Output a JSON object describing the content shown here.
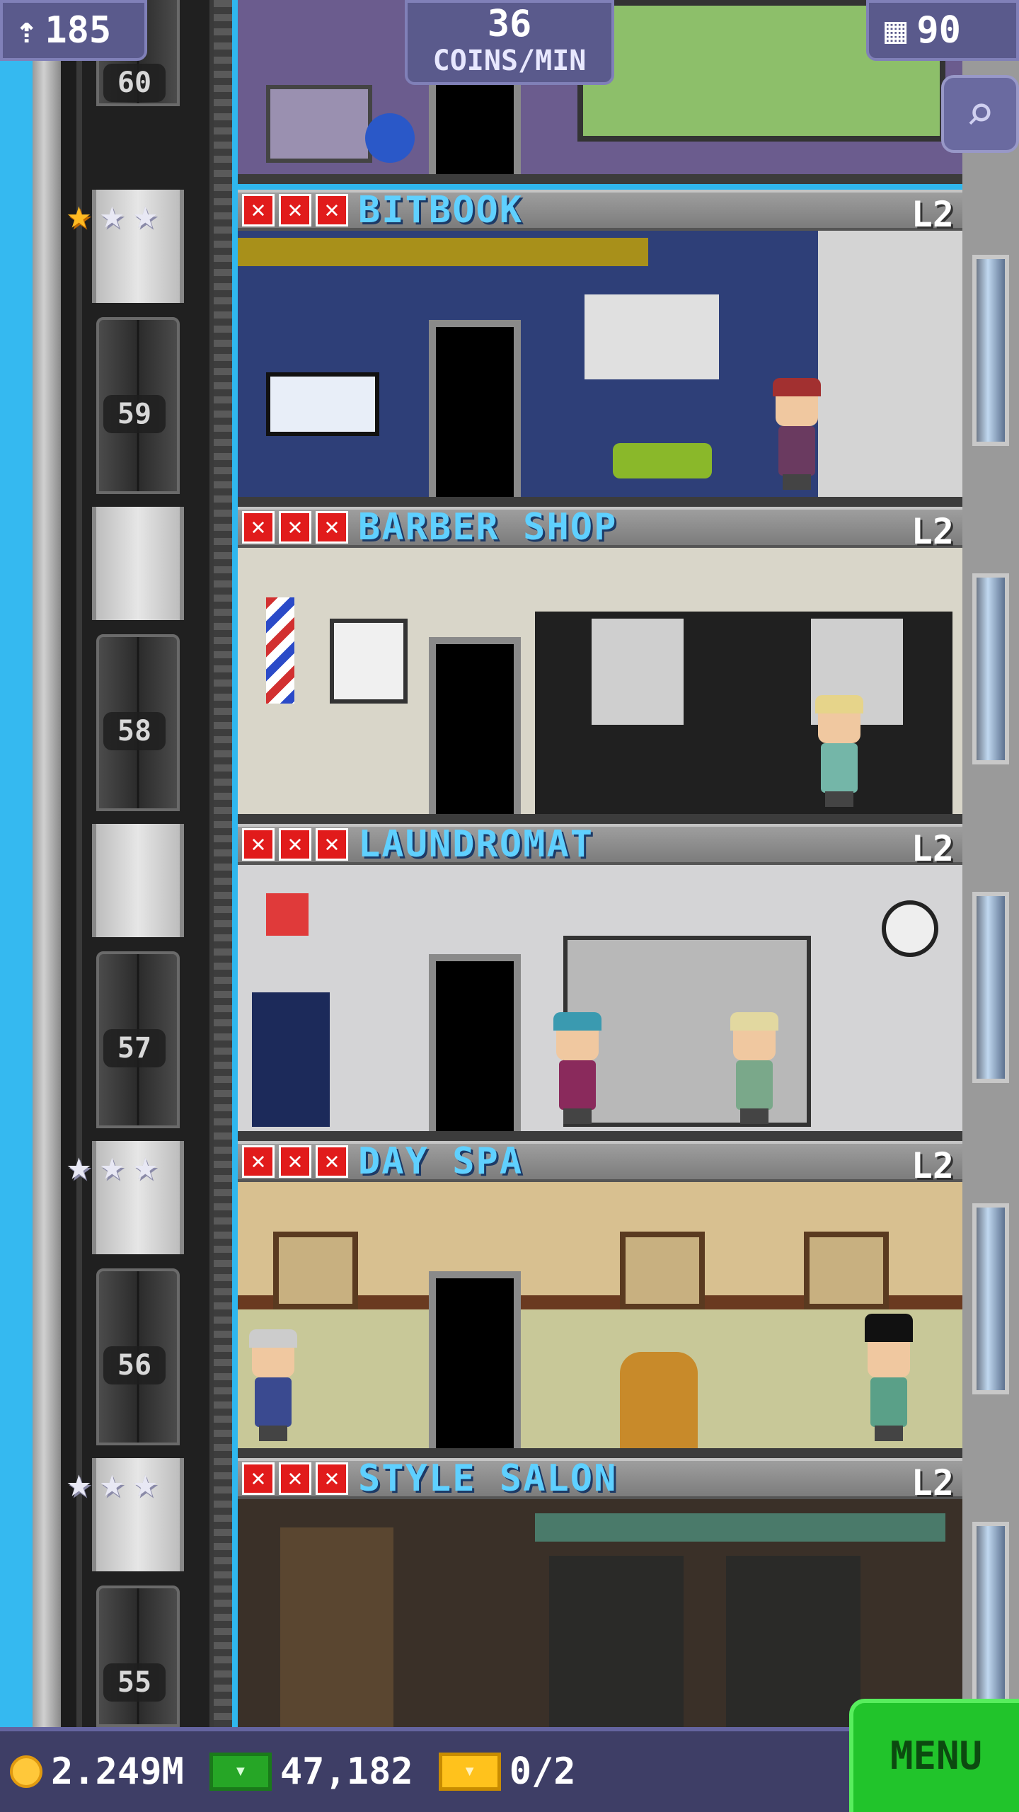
{
  "hud": {
    "population": "185",
    "coins_per_min_value": "36",
    "coins_per_min_unit": "COINS/MIN",
    "floor_count": "90"
  },
  "floors": [
    {
      "number": "60"
    },
    {
      "number": "59",
      "name": "BITBOOK",
      "level": "L2",
      "stars": [
        "gold",
        "silver",
        "silver"
      ]
    },
    {
      "number": "58",
      "name": "BARBER SHOP",
      "level": "L2"
    },
    {
      "number": "57",
      "name": "LAUNDROMAT",
      "level": "L2"
    },
    {
      "number": "56",
      "name": "DAY SPA",
      "level": "L2",
      "stars": [
        "silver",
        "silver",
        "silver"
      ]
    },
    {
      "number": "55",
      "name": "STYLE SALON",
      "level": "L2",
      "stars": [
        "silver",
        "silver",
        "silver"
      ]
    }
  ],
  "bottom_bar": {
    "coins": "2.249M",
    "bux": "47,182",
    "tickets": "0/2",
    "menu_label": "MENU"
  },
  "icons": {
    "population": "person-up-icon",
    "floors": "building-icon",
    "zoom": "magnifier-icon",
    "coin": "coin-icon",
    "bux": "bux-icon",
    "ticket": "ticket-icon"
  },
  "colors": {
    "floor_name": "#5fd0ff",
    "menu_button": "#21c42b",
    "hud": "#5a5a8c",
    "mark_x": "#e11b1b"
  }
}
